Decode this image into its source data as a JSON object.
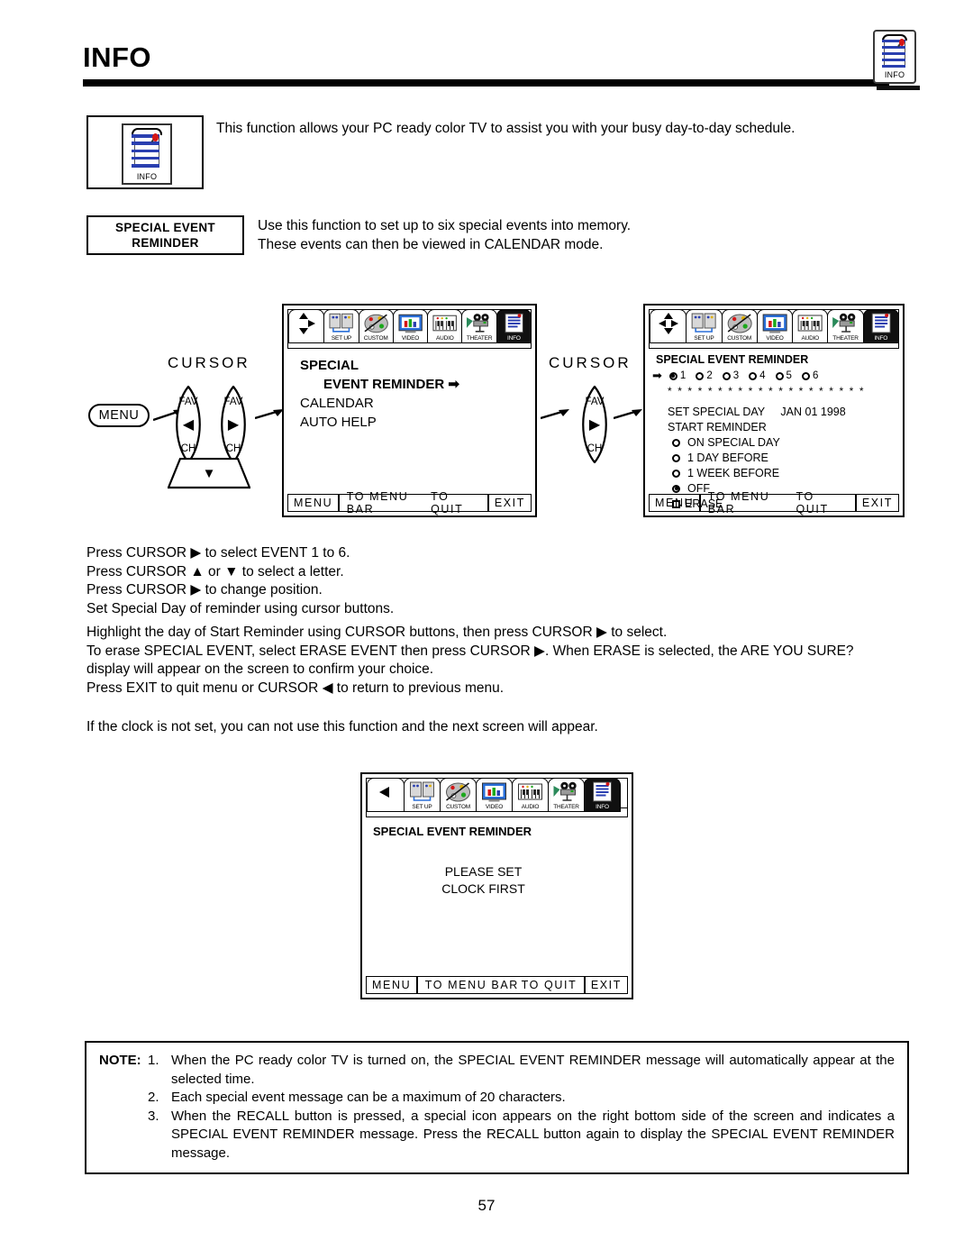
{
  "page": {
    "title": "INFO",
    "number": "57",
    "corner_icon": "info-icon",
    "corner_icon_label": "INFO"
  },
  "intro": {
    "icon_label": "INFO",
    "text": "This function allows your PC ready color TV to assist you with your busy day-to-day schedule."
  },
  "feature": {
    "label_line1": "SPECIAL EVENT",
    "label_line2": "REMINDER",
    "desc_line1": "Use this function to set up to six special events into memory.",
    "desc_line2": "These events can then be viewed in CALENDAR mode."
  },
  "nav": {
    "menu_button": "MENU",
    "cursor_label_left": "CURSOR",
    "cursor_label_right": "CURSOR",
    "fav": "FAV",
    "ch": "CH",
    "left_glyph": "◀",
    "right_glyph": "▶",
    "down_glyph": "▼"
  },
  "menubar_tabs": [
    {
      "label": "SET UP",
      "icon": "setup-icon"
    },
    {
      "label": "CUSTOM",
      "icon": "custom-palette-icon"
    },
    {
      "label": "VIDEO",
      "icon": "video-monitor-icon"
    },
    {
      "label": "AUDIO",
      "icon": "audio-keyboard-icon"
    },
    {
      "label": "THEATER",
      "icon": "theater-projector-icon"
    },
    {
      "label": "INFO",
      "icon": "info-notepad-icon"
    }
  ],
  "bottom_bar": {
    "menu": "MENU",
    "to_menu_bar": "TO MENU BAR",
    "to_quit": "TO QUIT",
    "exit": "EXIT"
  },
  "screen1": {
    "nav_glyphs": "up-right-down-arrows",
    "items": [
      {
        "text": "SPECIAL",
        "bold": true
      },
      {
        "text": "EVENT REMINDER",
        "bold": true,
        "indent": true,
        "arrow": "➡"
      },
      {
        "text": "CALENDAR",
        "bold": false
      },
      {
        "text": "AUTO HELP",
        "bold": false
      }
    ]
  },
  "screen2": {
    "nav_glyphs": "four-way-arrows",
    "heading": "SPECIAL EVENT REMINDER",
    "pointer": "➡",
    "events": [
      {
        "num": "1",
        "selected": true
      },
      {
        "num": "2",
        "selected": false
      },
      {
        "num": "3",
        "selected": false
      },
      {
        "num": "4",
        "selected": false
      },
      {
        "num": "5",
        "selected": false
      },
      {
        "num": "6",
        "selected": false
      }
    ],
    "message_placeholder": "* * * * * * * * * * * * * * * * * * * *",
    "set_special_day_label": "SET SPECIAL DAY",
    "set_special_day_value": "JAN 01 1998",
    "start_reminder_label": "START REMINDER",
    "options": [
      {
        "label": "ON SPECIAL DAY",
        "type": "radio",
        "selected": false
      },
      {
        "label": "1 DAY BEFORE",
        "type": "radio",
        "selected": false
      },
      {
        "label": "1 WEEK BEFORE",
        "type": "radio",
        "selected": false
      },
      {
        "label": "OFF",
        "type": "radio",
        "selected": true
      },
      {
        "label": "ERASE",
        "type": "checkbox",
        "selected": false
      }
    ]
  },
  "screen3": {
    "nav_glyphs": "left-arrow",
    "heading": "SPECIAL EVENT REMINDER",
    "message_line1": "PLEASE SET",
    "message_line2": "CLOCK FIRST"
  },
  "instructions": {
    "block1": [
      "Press CURSOR ▶ to select EVENT 1 to 6.",
      "Press CURSOR ▲ or ▼ to select a letter.",
      "Press CURSOR ▶ to change position.",
      "Set Special Day of reminder using cursor buttons."
    ],
    "block2_line1": "Highlight the day of Start Reminder using CURSOR buttons, then press CURSOR ▶ to select.",
    "block2_line2": "To erase SPECIAL EVENT, select ERASE EVENT then press CURSOR ▶. When ERASE is selected, the  ARE YOU SURE?",
    "block2_line3": "display will appear on the screen to confirm your choice.",
    "block2_line4": "Press EXIT to quit menu or CURSOR ◀ to return to previous menu.",
    "block3": "If the clock is not set, you can not use this function and the next screen will appear."
  },
  "note": {
    "label": "NOTE:",
    "items": [
      {
        "num": "1.",
        "text": "When the PC ready color TV is turned on, the SPECIAL EVENT REMINDER message will automatically appear at the selected time."
      },
      {
        "num": "2.",
        "text": "Each special event message can be a maximum of 20 characters."
      },
      {
        "num": "3.",
        "text": "When the RECALL button is pressed, a special icon appears on the right bottom side of the screen and indicates a SPECIAL EVENT REMINDER message. Press the RECALL button again to display the SPECIAL EVENT REMINDER message."
      }
    ]
  },
  "colors": {
    "ink": "#000000",
    "paper": "#ffffff",
    "icon_blue": "#2a3fb0",
    "icon_red": "#d41515",
    "icon_green": "#1ca81c"
  }
}
